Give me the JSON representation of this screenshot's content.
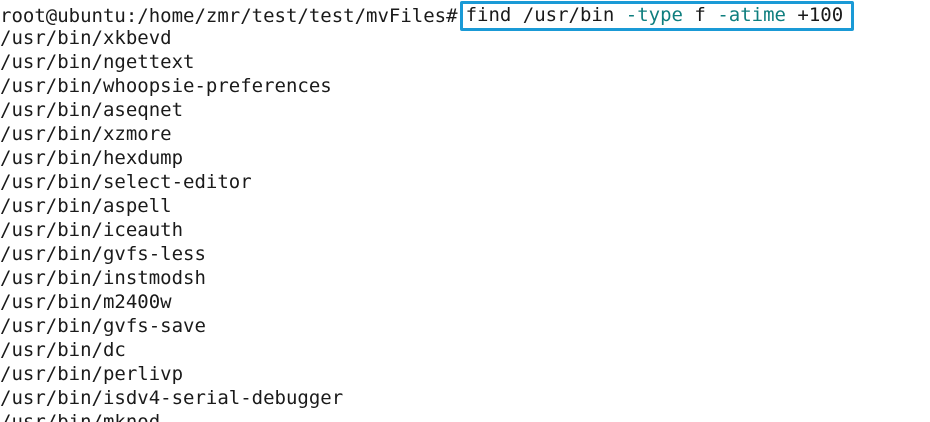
{
  "prompt": "root@ubuntu:/home/zmr/test/test/mvFiles#",
  "command": {
    "name": "find",
    "path": "/usr/bin",
    "flag1": "-type",
    "arg1": "f",
    "flag2": "-atime",
    "arg2": "+100"
  },
  "colors": {
    "highlight_border": "#1a9ad6",
    "flag_color": "#0e7e7e",
    "text": "#1a1a1a"
  },
  "output": [
    "/usr/bin/xkbevd",
    "/usr/bin/ngettext",
    "/usr/bin/whoopsie-preferences",
    "/usr/bin/aseqnet",
    "/usr/bin/xzmore",
    "/usr/bin/hexdump",
    "/usr/bin/select-editor",
    "/usr/bin/aspell",
    "/usr/bin/iceauth",
    "/usr/bin/gvfs-less",
    "/usr/bin/instmodsh",
    "/usr/bin/m2400w",
    "/usr/bin/gvfs-save",
    "/usr/bin/dc",
    "/usr/bin/perlivp",
    "/usr/bin/isdv4-serial-debugger",
    "/usr/bin/mknod"
  ]
}
